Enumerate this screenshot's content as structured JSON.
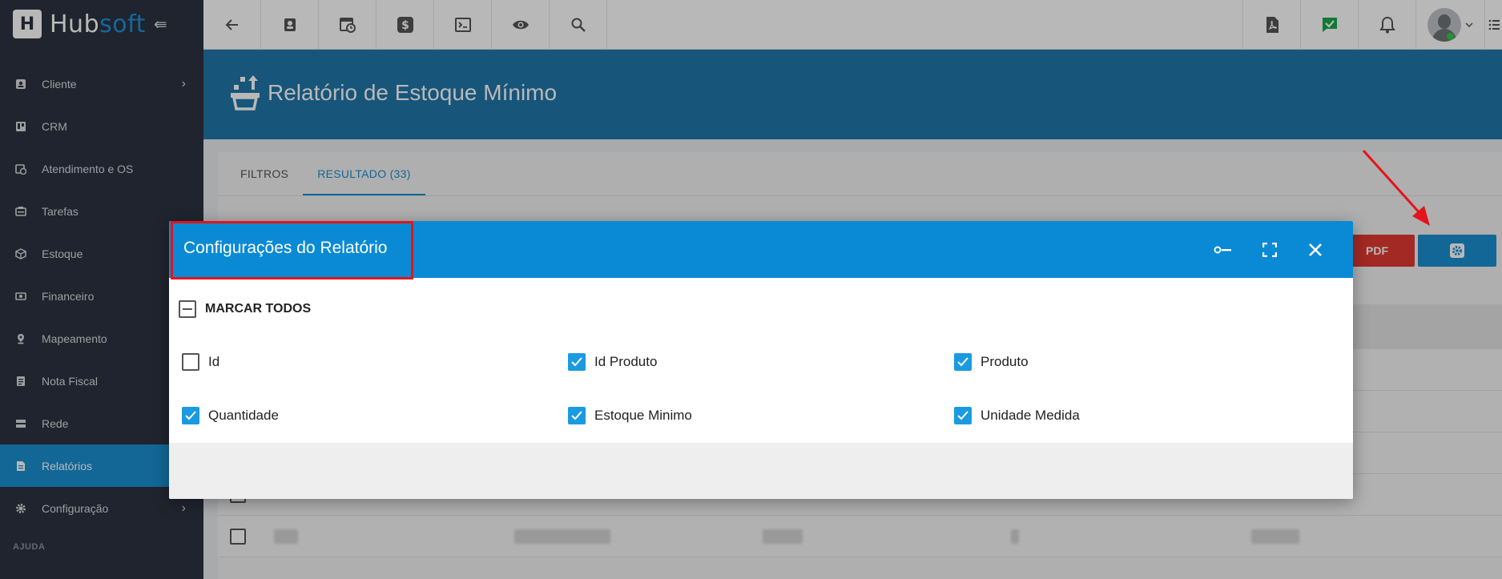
{
  "brand": {
    "name_main": "Hub",
    "name_accent": "soft"
  },
  "sidebar": {
    "items": [
      {
        "label": "Cliente",
        "icon": "contact-card-icon",
        "chevron": "›"
      },
      {
        "label": "CRM",
        "icon": "kanban-icon"
      },
      {
        "label": "Atendimento e OS",
        "icon": "calendar-clock-icon"
      },
      {
        "label": "Tarefas",
        "icon": "tasks-icon"
      },
      {
        "label": "Estoque",
        "icon": "box-icon"
      },
      {
        "label": "Financeiro",
        "icon": "money-icon"
      },
      {
        "label": "Mapeamento",
        "icon": "map-pin-icon"
      },
      {
        "label": "Nota Fiscal",
        "icon": "document-icon"
      },
      {
        "label": "Rede",
        "icon": "server-icon"
      },
      {
        "label": "Relatórios",
        "icon": "report-icon",
        "active": true
      },
      {
        "label": "Configuração",
        "icon": "gear-icon",
        "chevron": "›"
      }
    ],
    "section_help": "AJUDA"
  },
  "page": {
    "title": "Relatório de Estoque Mínimo"
  },
  "tabs": [
    {
      "label": "FILTROS"
    },
    {
      "label": "RESULTADO (33)",
      "active": true
    }
  ],
  "toolbar": {
    "pdf_label": "PDF"
  },
  "modal": {
    "title": "Configurações do Relatório",
    "mark_all_label": "MARCAR TODOS",
    "fields": [
      {
        "label": "Id",
        "checked": false
      },
      {
        "label": "Id Produto",
        "checked": true
      },
      {
        "label": "Produto",
        "checked": true
      },
      {
        "label": "Quantidade",
        "checked": true
      },
      {
        "label": "Estoque Minimo",
        "checked": true
      },
      {
        "label": "Unidade Medida",
        "checked": true
      }
    ]
  },
  "colors": {
    "accent": "#1a8fd1",
    "sidebar": "#2d3340",
    "modal_header": "#0a8ad4",
    "pdf": "#e23a32",
    "annotation": "#e3141b"
  }
}
